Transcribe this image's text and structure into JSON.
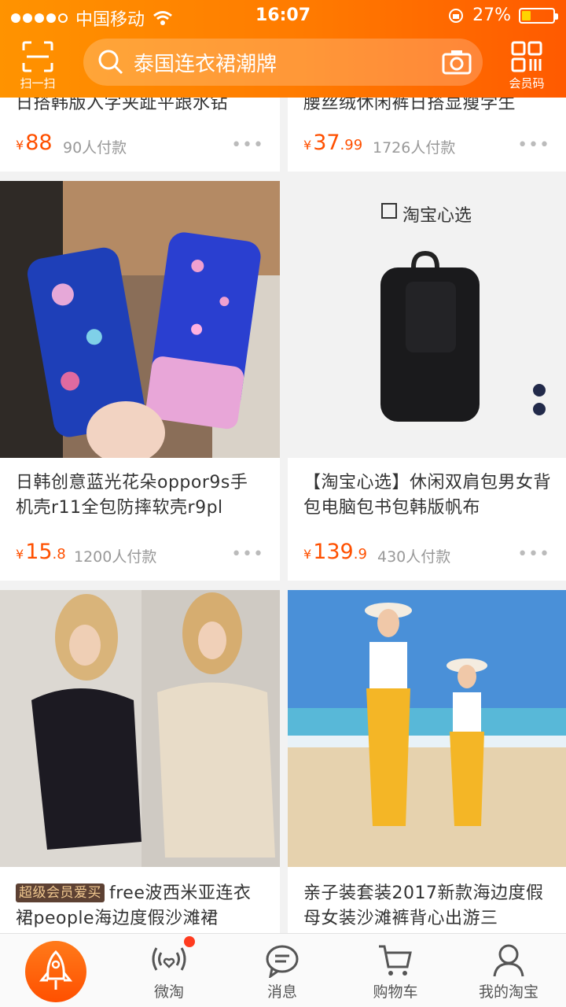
{
  "status_bar": {
    "carrier": "中国移动",
    "time": "16:07",
    "battery": "27%",
    "battery_level": 0.27
  },
  "header": {
    "scan_label": "扫一扫",
    "search_placeholder": "泰国连衣裙潮牌",
    "member_label": "会员码"
  },
  "products": [
    {
      "title": "日搭韩版入字夹趾平跟水钻",
      "price_int": "88",
      "price_dec": "",
      "sold": "90人付款"
    },
    {
      "title": "腰丝绒休闲裤日搭显瘦学生",
      "price_int": "37",
      "price_dec": ".99",
      "sold": "1726人付款"
    },
    {
      "title": "日韩创意蓝光花朵oppor9s手机壳r11全包防摔软壳r9pl",
      "price_int": "15",
      "price_dec": ".8",
      "sold": "1200人付款"
    },
    {
      "title": "【淘宝心选】休闲双肩包男女背包电脑包书包韩版帆布",
      "brand_mark": "淘宝心选",
      "price_int": "139",
      "price_dec": ".9",
      "sold": "430人付款"
    },
    {
      "badge": "超级会员爱买",
      "title": "free波西米亚连衣裙people海边度假沙滩裙"
    },
    {
      "title": "亲子装套装2017新款海边度假母女装沙滩裤背心出游三"
    }
  ],
  "price_symbol": "¥",
  "more_symbol": "•••",
  "tabbar": {
    "items": [
      {
        "label": "微淘",
        "icon": "weitao-icon"
      },
      {
        "label": "消息",
        "icon": "message-icon"
      },
      {
        "label": "购物车",
        "icon": "cart-icon"
      },
      {
        "label": "我的淘宝",
        "icon": "profile-icon"
      }
    ]
  },
  "colors": {
    "brand_orange": "#ff5000",
    "header_start": "#ff9300",
    "header_end": "#ff5a00"
  }
}
